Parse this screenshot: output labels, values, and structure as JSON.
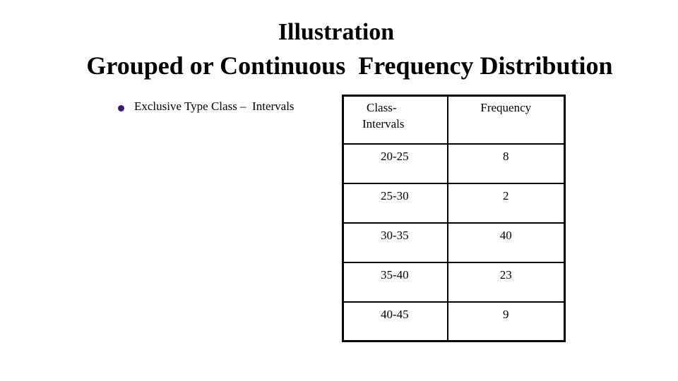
{
  "slide": {
    "title_line1": "Illustration",
    "title_line2": "Grouped or Continuous  Frequency Distribution",
    "bullet": {
      "icon": "bullet-dot",
      "color": "#3d1a6e",
      "text": "Exclusive Type Class –  Intervals"
    }
  },
  "table": {
    "headers": [
      "Class-\nIntervals",
      "Frequency"
    ],
    "header_class_line1": "Class-",
    "header_class_line2": "Intervals",
    "header_frequency": "Frequency",
    "rows": [
      {
        "interval": "20-25",
        "frequency": "8"
      },
      {
        "interval": "25-30",
        "frequency": "2"
      },
      {
        "interval": "30-35",
        "frequency": "40"
      },
      {
        "interval": "35-40",
        "frequency": "23"
      },
      {
        "interval": "40-45",
        "frequency": "9"
      }
    ]
  }
}
